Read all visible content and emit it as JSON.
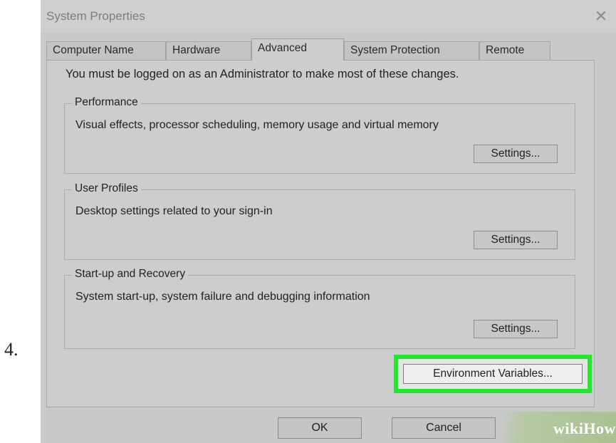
{
  "step": {
    "number": "4."
  },
  "window": {
    "title": "System Properties",
    "close_icon": "✕"
  },
  "tabs": [
    {
      "label": "Computer Name",
      "active": false
    },
    {
      "label": "Hardware",
      "active": false
    },
    {
      "label": "Advanced",
      "active": true
    },
    {
      "label": "System Protection",
      "active": false
    },
    {
      "label": "Remote",
      "active": false
    }
  ],
  "advanced": {
    "admin_note": "You must be logged on as an Administrator to make most of these changes.",
    "groups": [
      {
        "legend": "Performance",
        "description": "Visual effects, processor scheduling, memory usage and virtual memory",
        "button": "Settings..."
      },
      {
        "legend": "User Profiles",
        "description": "Desktop settings related to your sign-in",
        "button": "Settings..."
      },
      {
        "legend": "Start-up and Recovery",
        "description": "System start-up, system failure and debugging information",
        "button": "Settings..."
      }
    ],
    "env_button": "Environment Variables...",
    "highlight_color": "#22e82c"
  },
  "footer": {
    "ok": "OK",
    "cancel": "Cancel"
  },
  "watermark": {
    "text": "wikiHow",
    "icon": "wikihow-logo"
  }
}
